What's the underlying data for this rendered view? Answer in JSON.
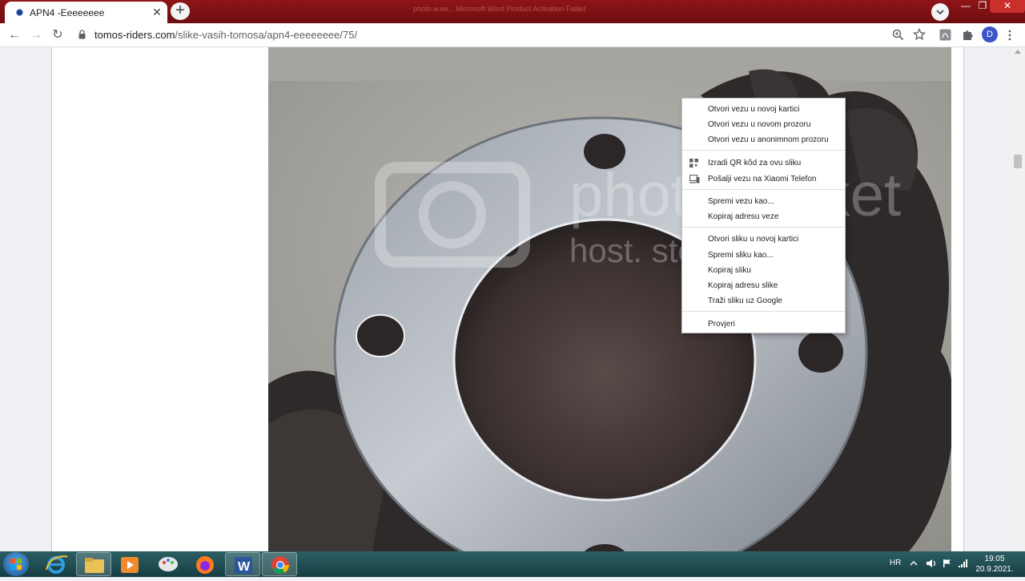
{
  "tab": {
    "title": "APN4 -Eeeeeeee",
    "close": "✕",
    "new_tab": "+"
  },
  "ghost_title": "photo w.ee... Microsoft Word   Product Activation Failed",
  "window": {
    "minimize": "—",
    "maximize": "❐",
    "close": "✕"
  },
  "nav": {
    "back": "←",
    "forward": "→",
    "reload": "↻"
  },
  "address": {
    "host": "tomos-riders.com",
    "path": "/slike-vasih-tomosa/apn4-eeeeeeee/75/"
  },
  "profile_initial": "D",
  "watermark": {
    "line1": "photobucket",
    "line2": "host. store. share."
  },
  "context_menu": {
    "items": [
      {
        "label": "Otvori vezu u novoj kartici"
      },
      {
        "label": "Otvori vezu u novom prozoru"
      },
      {
        "label": "Otvori vezu u anonimnom prozoru"
      },
      {
        "label": "Izradi QR kôd za ovu sliku",
        "icon": "qr-code-icon"
      },
      {
        "label": "Pošalji vezu na Xiaomi Telefon",
        "icon": "send-to-device-icon"
      },
      {
        "label": "Spremi vezu kao..."
      },
      {
        "label": "Kopiraj adresu veze"
      },
      {
        "label": "Otvori sliku u novoj kartici"
      },
      {
        "label": "Spremi sliku kao..."
      },
      {
        "label": "Kopiraj sliku"
      },
      {
        "label": "Kopiraj adresu slike"
      },
      {
        "label": "Traži sliku uz Google"
      },
      {
        "label": "Provjeri"
      }
    ]
  },
  "taskbar": {
    "apps": [
      "windows-start",
      "internet-explorer",
      "file-explorer",
      "media-player",
      "paint",
      "firefox",
      "microsoft-word",
      "google-chrome"
    ],
    "language": "HR",
    "time": "19:05",
    "date": "20.9.2021."
  }
}
